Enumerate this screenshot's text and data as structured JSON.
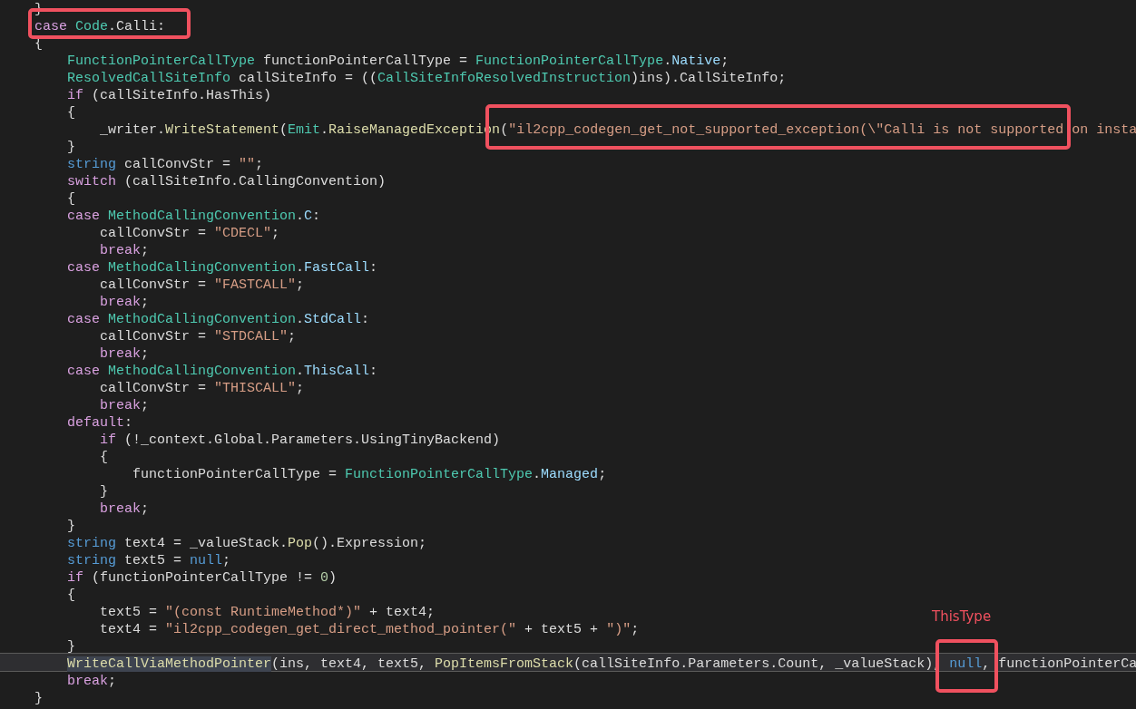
{
  "code_lines": [
    {
      "current": false,
      "tokens": [
        {
          "text": "}",
          "kind": "plain"
        }
      ]
    },
    {
      "current": false,
      "tokens": [
        {
          "text": "case ",
          "kind": "control"
        },
        {
          "text": "Code",
          "kind": "type"
        },
        {
          "text": ".Calli:",
          "kind": "plain"
        }
      ]
    },
    {
      "current": false,
      "tokens": [
        {
          "text": "{",
          "kind": "plain"
        }
      ],
      "children": [
        {
          "current": false,
          "tokens": [
            {
              "text": "FunctionPointerCallType",
              "kind": "type"
            },
            {
              "text": " functionPointerCallType = ",
              "kind": "plain"
            },
            {
              "text": "FunctionPointerCallType",
              "kind": "type"
            },
            {
              "text": ".",
              "kind": "plain"
            },
            {
              "text": "Native",
              "kind": "member"
            },
            {
              "text": ";",
              "kind": "plain"
            }
          ]
        },
        {
          "current": false,
          "tokens": [
            {
              "text": "ResolvedCallSiteInfo",
              "kind": "type"
            },
            {
              "text": " callSiteInfo = ((",
              "kind": "plain"
            },
            {
              "text": "CallSiteInfoResolvedInstruction",
              "kind": "type"
            },
            {
              "text": ")ins).CallSiteInfo;",
              "kind": "plain"
            }
          ]
        },
        {
          "current": false,
          "tokens": [
            {
              "text": "if",
              "kind": "control"
            },
            {
              "text": " (callSiteInfo.HasThis)",
              "kind": "plain"
            }
          ]
        },
        {
          "current": false,
          "tokens": [
            {
              "text": "{",
              "kind": "plain"
            }
          ],
          "children": [
            {
              "current": false,
              "tokens": [
                {
                  "text": "_writer.",
                  "kind": "plain"
                },
                {
                  "text": "WriteStatement",
                  "kind": "method"
                },
                {
                  "text": "(",
                  "kind": "plain"
                },
                {
                  "text": "Emit",
                  "kind": "type"
                },
                {
                  "text": ".",
                  "kind": "plain"
                },
                {
                  "text": "RaiseManagedException",
                  "kind": "method"
                },
                {
                  "text": "(",
                  "kind": "plain"
                },
                {
                  "text": "\"il2cpp_codegen_get_not_supported_exception(\\\"Calli is not supported on insta",
                  "kind": "string"
                }
              ]
            }
          ]
        },
        {
          "current": false,
          "tokens": [
            {
              "text": "}",
              "kind": "plain"
            }
          ]
        },
        {
          "current": false,
          "tokens": [
            {
              "text": "string",
              "kind": "keyword"
            },
            {
              "text": " callConvStr = ",
              "kind": "plain"
            },
            {
              "text": "\"\"",
              "kind": "string"
            },
            {
              "text": ";",
              "kind": "plain"
            }
          ]
        },
        {
          "current": false,
          "tokens": [
            {
              "text": "switch",
              "kind": "control"
            },
            {
              "text": " (callSiteInfo.CallingConvention)",
              "kind": "plain"
            }
          ]
        },
        {
          "current": false,
          "tokens": [
            {
              "text": "{",
              "kind": "plain"
            }
          ]
        },
        {
          "current": false,
          "tokens": [
            {
              "text": "case ",
              "kind": "control"
            },
            {
              "text": "MethodCallingConvention",
              "kind": "type"
            },
            {
              "text": ".",
              "kind": "plain"
            },
            {
              "text": "C",
              "kind": "member"
            },
            {
              "text": ":",
              "kind": "plain"
            }
          ],
          "children": [
            {
              "current": false,
              "tokens": [
                {
                  "text": "callConvStr = ",
                  "kind": "plain"
                },
                {
                  "text": "\"CDECL\"",
                  "kind": "string"
                },
                {
                  "text": ";",
                  "kind": "plain"
                }
              ]
            },
            {
              "current": false,
              "tokens": [
                {
                  "text": "break",
                  "kind": "control"
                },
                {
                  "text": ";",
                  "kind": "plain"
                }
              ]
            }
          ]
        },
        {
          "current": false,
          "tokens": [
            {
              "text": "case ",
              "kind": "control"
            },
            {
              "text": "MethodCallingConvention",
              "kind": "type"
            },
            {
              "text": ".",
              "kind": "plain"
            },
            {
              "text": "FastCall",
              "kind": "member"
            },
            {
              "text": ":",
              "kind": "plain"
            }
          ],
          "children": [
            {
              "current": false,
              "tokens": [
                {
                  "text": "callConvStr = ",
                  "kind": "plain"
                },
                {
                  "text": "\"FASTCALL\"",
                  "kind": "string"
                },
                {
                  "text": ";",
                  "kind": "plain"
                }
              ]
            },
            {
              "current": false,
              "tokens": [
                {
                  "text": "break",
                  "kind": "control"
                },
                {
                  "text": ";",
                  "kind": "plain"
                }
              ]
            }
          ]
        },
        {
          "current": false,
          "tokens": [
            {
              "text": "case ",
              "kind": "control"
            },
            {
              "text": "MethodCallingConvention",
              "kind": "type"
            },
            {
              "text": ".",
              "kind": "plain"
            },
            {
              "text": "StdCall",
              "kind": "member"
            },
            {
              "text": ":",
              "kind": "plain"
            }
          ],
          "children": [
            {
              "current": false,
              "tokens": [
                {
                  "text": "callConvStr = ",
                  "kind": "plain"
                },
                {
                  "text": "\"STDCALL\"",
                  "kind": "string"
                },
                {
                  "text": ";",
                  "kind": "plain"
                }
              ]
            },
            {
              "current": false,
              "tokens": [
                {
                  "text": "break",
                  "kind": "control"
                },
                {
                  "text": ";",
                  "kind": "plain"
                }
              ]
            }
          ]
        },
        {
          "current": false,
          "tokens": [
            {
              "text": "case ",
              "kind": "control"
            },
            {
              "text": "MethodCallingConvention",
              "kind": "type"
            },
            {
              "text": ".",
              "kind": "plain"
            },
            {
              "text": "ThisCall",
              "kind": "member"
            },
            {
              "text": ":",
              "kind": "plain"
            }
          ],
          "children": [
            {
              "current": false,
              "tokens": [
                {
                  "text": "callConvStr = ",
                  "kind": "plain"
                },
                {
                  "text": "\"THISCALL\"",
                  "kind": "string"
                },
                {
                  "text": ";",
                  "kind": "plain"
                }
              ]
            },
            {
              "current": false,
              "tokens": [
                {
                  "text": "break",
                  "kind": "control"
                },
                {
                  "text": ";",
                  "kind": "plain"
                }
              ]
            }
          ]
        },
        {
          "current": false,
          "tokens": [
            {
              "text": "default",
              "kind": "control"
            },
            {
              "text": ":",
              "kind": "plain"
            }
          ],
          "children": [
            {
              "current": false,
              "tokens": [
                {
                  "text": "if",
                  "kind": "control"
                },
                {
                  "text": " (!_context.Global.Parameters.UsingTinyBackend)",
                  "kind": "plain"
                }
              ]
            },
            {
              "current": false,
              "tokens": [
                {
                  "text": "{",
                  "kind": "plain"
                }
              ],
              "children": [
                {
                  "current": false,
                  "tokens": [
                    {
                      "text": "functionPointerCallType = ",
                      "kind": "plain"
                    },
                    {
                      "text": "FunctionPointerCallType",
                      "kind": "type"
                    },
                    {
                      "text": ".",
                      "kind": "plain"
                    },
                    {
                      "text": "Managed",
                      "kind": "member"
                    },
                    {
                      "text": ";",
                      "kind": "plain"
                    }
                  ]
                }
              ]
            },
            {
              "current": false,
              "tokens": [
                {
                  "text": "}",
                  "kind": "plain"
                }
              ]
            },
            {
              "current": false,
              "tokens": [
                {
                  "text": "break",
                  "kind": "control"
                },
                {
                  "text": ";",
                  "kind": "plain"
                }
              ]
            }
          ]
        },
        {
          "current": false,
          "tokens": [
            {
              "text": "}",
              "kind": "plain"
            }
          ]
        },
        {
          "current": false,
          "tokens": [
            {
              "text": "string",
              "kind": "keyword"
            },
            {
              "text": " text4 = _valueStack.",
              "kind": "plain"
            },
            {
              "text": "Pop",
              "kind": "method"
            },
            {
              "text": "().Expression;",
              "kind": "plain"
            }
          ]
        },
        {
          "current": false,
          "tokens": [
            {
              "text": "string",
              "kind": "keyword"
            },
            {
              "text": " text5 = ",
              "kind": "plain"
            },
            {
              "text": "null",
              "kind": "keyword"
            },
            {
              "text": ";",
              "kind": "plain"
            }
          ]
        },
        {
          "current": false,
          "tokens": [
            {
              "text": "if",
              "kind": "control"
            },
            {
              "text": " (functionPointerCallType != ",
              "kind": "plain"
            },
            {
              "text": "0",
              "kind": "number"
            },
            {
              "text": ")",
              "kind": "plain"
            }
          ]
        },
        {
          "current": false,
          "tokens": [
            {
              "text": "{",
              "kind": "plain"
            }
          ],
          "children": [
            {
              "current": false,
              "tokens": [
                {
                  "text": "text5 = ",
                  "kind": "plain"
                },
                {
                  "text": "\"(const RuntimeMethod*)\"",
                  "kind": "string"
                },
                {
                  "text": " + text4;",
                  "kind": "plain"
                }
              ]
            },
            {
              "current": false,
              "tokens": [
                {
                  "text": "text4 = ",
                  "kind": "plain"
                },
                {
                  "text": "\"il2cpp_codegen_get_direct_method_pointer(\"",
                  "kind": "string"
                },
                {
                  "text": " + text5 + ",
                  "kind": "plain"
                },
                {
                  "text": "\")\"",
                  "kind": "string"
                },
                {
                  "text": ";",
                  "kind": "plain"
                }
              ]
            }
          ]
        },
        {
          "current": false,
          "tokens": [
            {
              "text": "}",
              "kind": "plain"
            }
          ]
        },
        {
          "current": true,
          "tokens": [
            {
              "text": "WriteCallViaMethodPointer",
              "kind": "highlighted-method"
            },
            {
              "text": "(ins, text4, text5, ",
              "kind": "plain"
            },
            {
              "text": "PopItemsFromStack",
              "kind": "method"
            },
            {
              "text": "(callSiteInfo.Parameters.Count, _valueStack), ",
              "kind": "plain"
            },
            {
              "text": "null",
              "kind": "keyword"
            },
            {
              "text": ", functionPointerCa",
              "kind": "plain"
            }
          ]
        },
        {
          "current": false,
          "tokens": [
            {
              "text": "break",
              "kind": "control"
            },
            {
              "text": ";",
              "kind": "plain"
            }
          ]
        }
      ]
    },
    {
      "current": false,
      "tokens": [
        {
          "text": "}",
          "kind": "plain"
        }
      ]
    }
  ],
  "annotations": [
    {
      "kind": "box"
    },
    {
      "kind": "box"
    },
    {
      "kind": "box"
    },
    {
      "kind": "label",
      "text": "ThisType"
    }
  ]
}
